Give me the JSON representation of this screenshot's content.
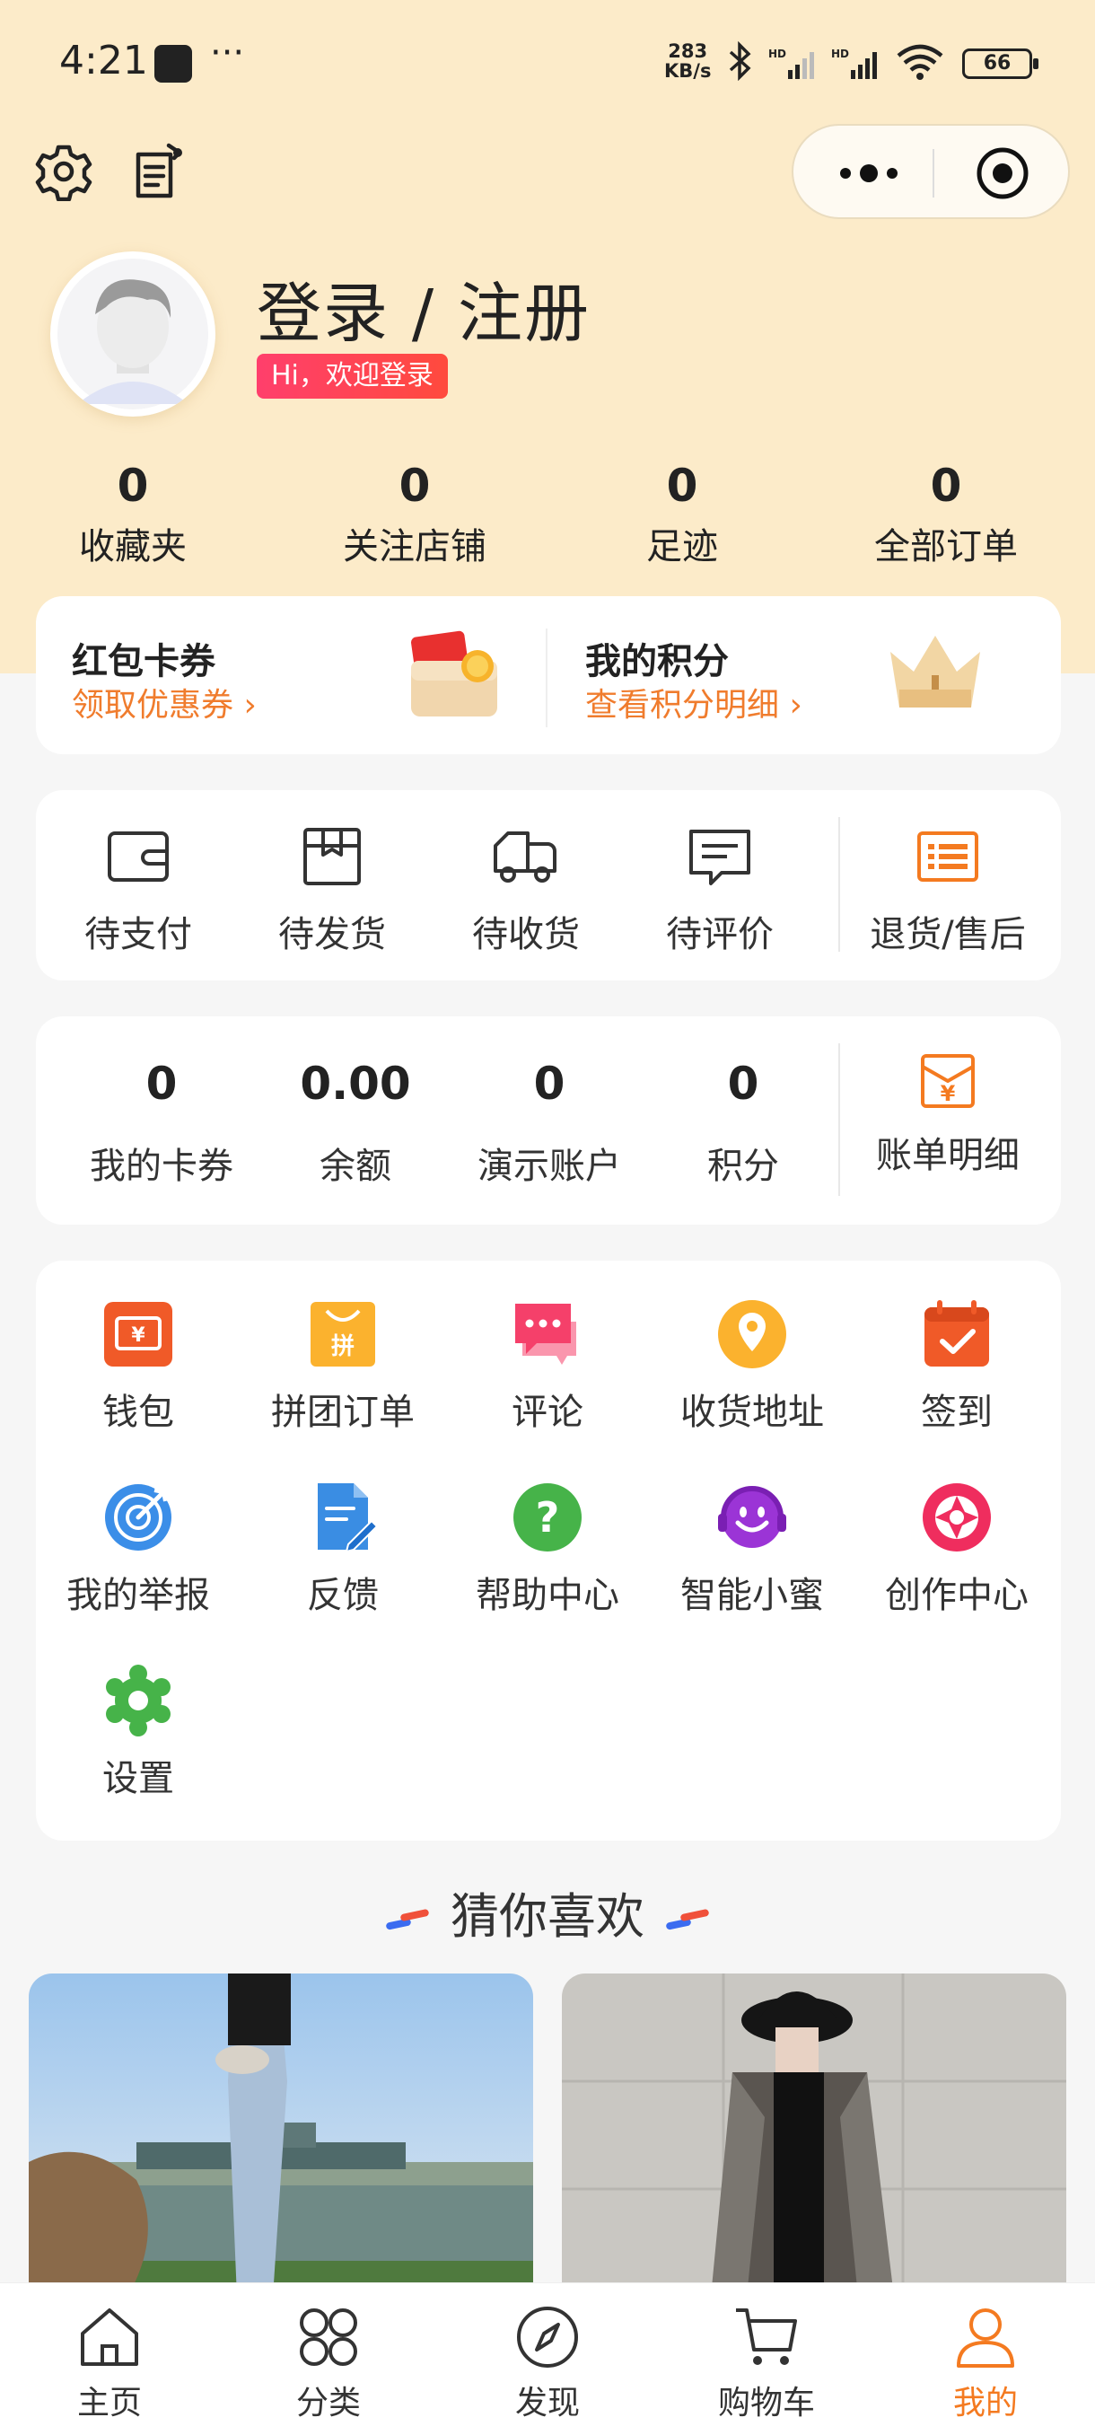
{
  "status_bar": {
    "time": "4:21",
    "dots": "···",
    "speed_top": "283",
    "speed_bottom": "KB/s",
    "battery": "66"
  },
  "profile": {
    "title": "登录 / 注册",
    "welcome": "Hi，欢迎登录"
  },
  "stats": [
    {
      "value": "0",
      "label": "收藏夹"
    },
    {
      "value": "0",
      "label": "关注店铺"
    },
    {
      "value": "0",
      "label": "足迹"
    },
    {
      "value": "0",
      "label": "全部订单"
    }
  ],
  "coupon_card": {
    "left_title": "红包卡券",
    "left_link": "领取优惠券 ›",
    "right_title": "我的积分",
    "right_link": "查看积分明细 ›"
  },
  "orders": [
    {
      "label": "待支付",
      "icon": "wallet-icon"
    },
    {
      "label": "待发货",
      "icon": "package-icon"
    },
    {
      "label": "待收货",
      "icon": "truck-icon"
    },
    {
      "label": "待评价",
      "icon": "comment-icon"
    },
    {
      "label": "退货/售后",
      "icon": "list-icon"
    }
  ],
  "account": [
    {
      "value": "0",
      "label": "我的卡券"
    },
    {
      "value": "0.00",
      "label": "余额"
    },
    {
      "value": "0",
      "label": "演示账户"
    },
    {
      "value": "0",
      "label": "积分"
    }
  ],
  "bill": {
    "label": "账单明细",
    "icon": "bill-icon"
  },
  "services": [
    {
      "label": "钱包",
      "icon": "wallet-icon"
    },
    {
      "label": "拼团订单",
      "icon": "group-bag-icon"
    },
    {
      "label": "评论",
      "icon": "comment-bubble-icon"
    },
    {
      "label": "收货地址",
      "icon": "location-icon"
    },
    {
      "label": "签到",
      "icon": "calendar-check-icon"
    },
    {
      "label": "我的举报",
      "icon": "target-icon"
    },
    {
      "label": "反馈",
      "icon": "feedback-doc-icon"
    },
    {
      "label": "帮助中心",
      "icon": "help-icon"
    },
    {
      "label": "智能小蜜",
      "icon": "smile-icon"
    },
    {
      "label": "创作中心",
      "icon": "aperture-icon"
    },
    {
      "label": "设置",
      "icon": "gear-icon"
    }
  ],
  "guess_title": "猜你喜欢",
  "tabs": [
    {
      "label": "主页",
      "icon": "home-icon"
    },
    {
      "label": "分类",
      "icon": "category-icon"
    },
    {
      "label": "发现",
      "icon": "compass-icon"
    },
    {
      "label": "购物车",
      "icon": "cart-icon"
    },
    {
      "label": "我的",
      "icon": "user-icon"
    }
  ],
  "colors": {
    "accent": "#f47a20",
    "header_bg": "#fcebc9",
    "page_bg": "#f6f6f6"
  }
}
